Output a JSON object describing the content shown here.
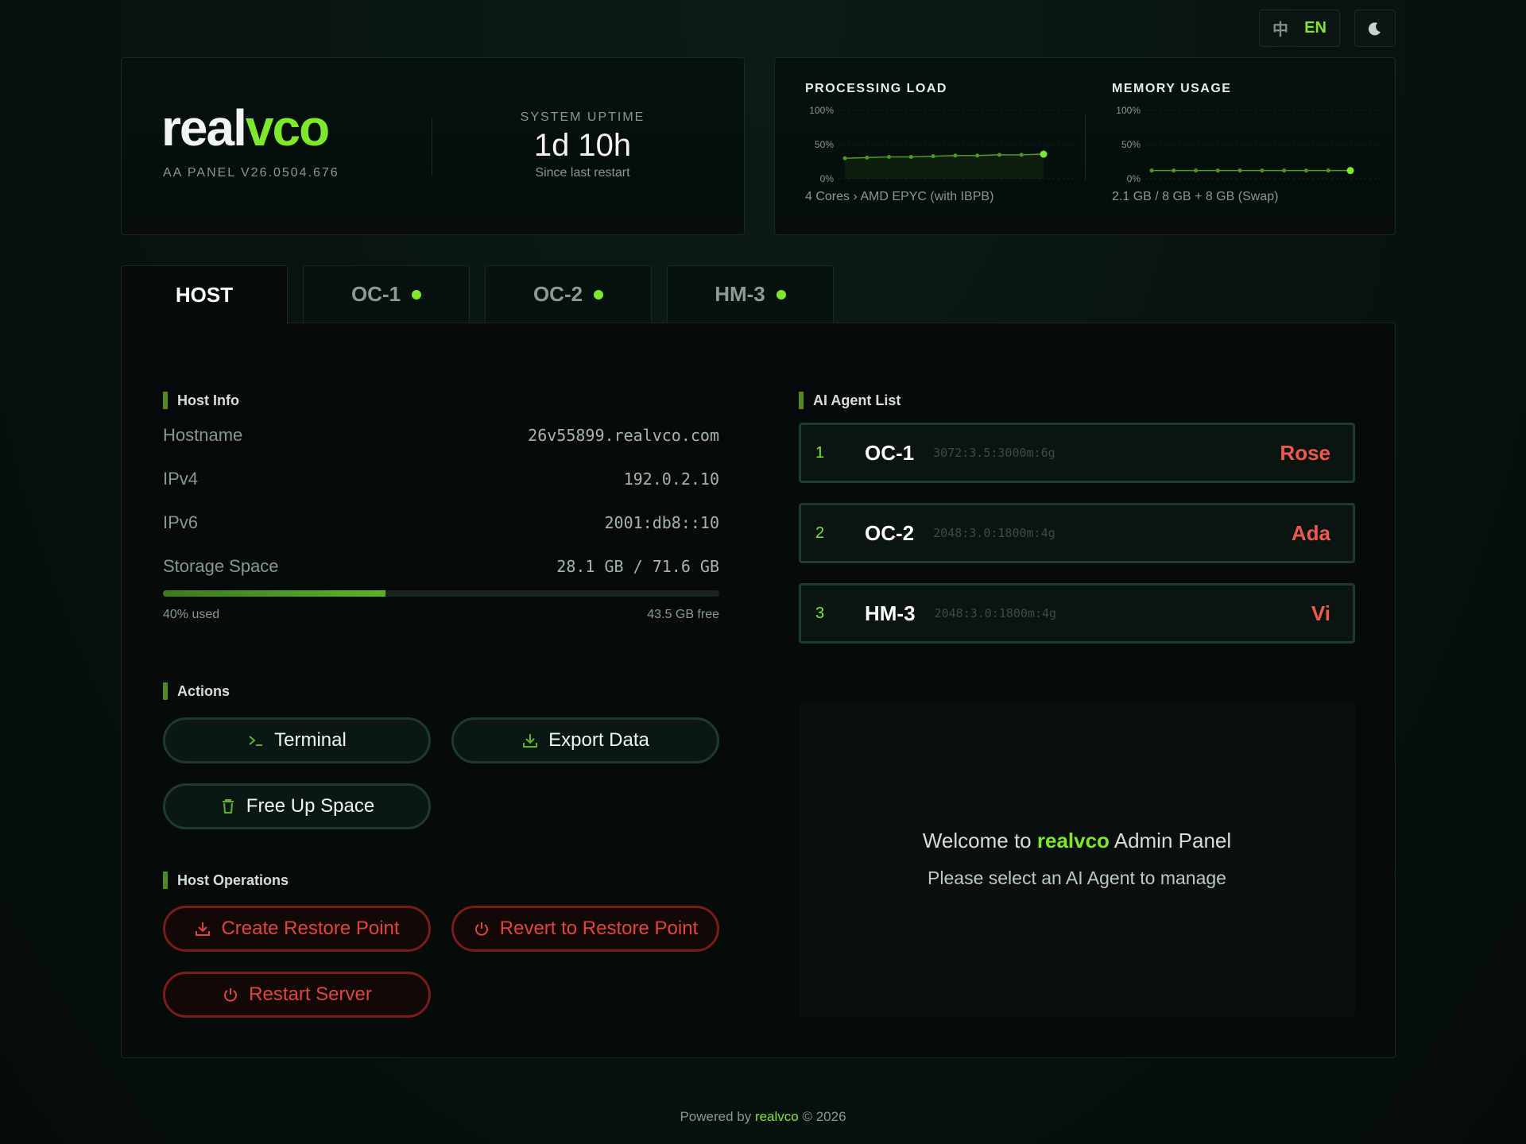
{
  "lang": {
    "zh": "中",
    "en": "EN"
  },
  "brand": {
    "name_a": "real",
    "name_b": "vco",
    "version": "AA PANEL V26.0504.676"
  },
  "uptime": {
    "label": "SYSTEM UPTIME",
    "value": "1d 10h",
    "sub": "Since last restart"
  },
  "metrics": {
    "cpu": {
      "title": "PROCESSING LOAD",
      "sub": "4 Cores › AMD EPYC (with IBPB)"
    },
    "mem": {
      "title": "MEMORY USAGE",
      "sub": "2.1 GB / 8 GB + 8 GB (Swap)"
    }
  },
  "chart_data": [
    {
      "type": "area",
      "title": "PROCESSING LOAD",
      "ylabel": "",
      "ylim": [
        0,
        100
      ],
      "yticks": [
        "100%",
        "50%",
        "0%"
      ],
      "values": [
        30,
        31,
        32,
        32,
        33,
        34,
        34,
        35,
        35,
        36
      ]
    },
    {
      "type": "line",
      "title": "MEMORY USAGE",
      "ylabel": "",
      "ylim": [
        0,
        100
      ],
      "yticks": [
        "100%",
        "50%",
        "0%"
      ],
      "values": [
        12,
        12,
        12,
        12,
        12,
        12,
        12,
        12,
        12,
        12
      ]
    }
  ],
  "tabs": [
    {
      "label": "HOST",
      "status": false
    },
    {
      "label": "OC-1",
      "status": true
    },
    {
      "label": "OC-2",
      "status": true
    },
    {
      "label": "HM-3",
      "status": true
    }
  ],
  "host_info": {
    "title": "Host Info",
    "rows": [
      {
        "key": "Hostname",
        "value": "26v55899.realvco.com"
      },
      {
        "key": "IPv4",
        "value": "192.0.2.10"
      },
      {
        "key": "IPv6",
        "value": "2001:db8::10"
      },
      {
        "key": "Storage Space",
        "value": "28.1 GB / 71.6 GB"
      }
    ],
    "storage_used_fraction": 0.4,
    "storage_used_label": "40% used",
    "storage_free_label": "43.5 GB free"
  },
  "actions": {
    "title": "Actions",
    "terminal": "Terminal",
    "export": "Export Data",
    "free_space": "Free Up Space"
  },
  "host_ops": {
    "title": "Host Operations",
    "create_restore": "Create Restore Point",
    "revert_restore": "Revert to Restore Point",
    "restart": "Restart Server"
  },
  "agents": {
    "title": "AI Agent List",
    "items": [
      {
        "num": "1",
        "name": "OC-1",
        "spec": "3072:3.5:3000m:6g",
        "role": "Rose"
      },
      {
        "num": "2",
        "name": "OC-2",
        "spec": "2048:3.0:1800m:4g",
        "role": "Ada"
      },
      {
        "num": "3",
        "name": "HM-3",
        "spec": "2048:3.0:1800m:4g",
        "role": "Vi"
      }
    ]
  },
  "welcome": {
    "prefix": "Welcome to ",
    "brand": "realvco",
    "suffix": " Admin Panel",
    "sub": "Please select an AI Agent to manage"
  },
  "footer": {
    "prefix": "Powered by ",
    "brand": "realvco",
    "suffix": " © 2026"
  },
  "colors": {
    "accent": "#7ee82c",
    "danger": "#e0463e",
    "bg": "#081210"
  }
}
